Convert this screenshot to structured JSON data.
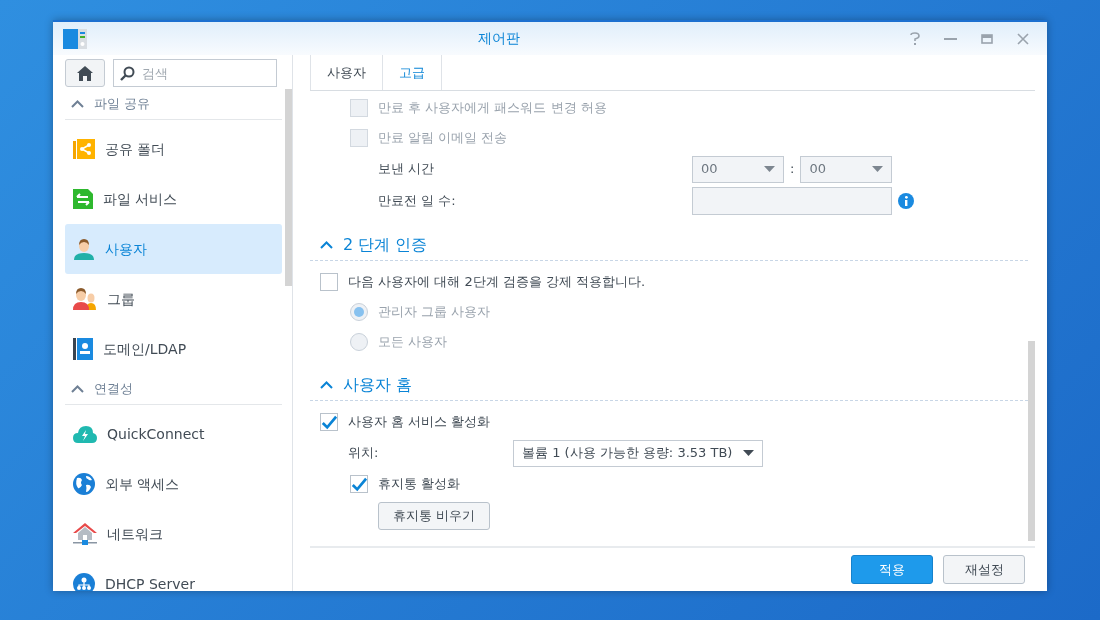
{
  "window": {
    "title": "제어판"
  },
  "sidebar": {
    "search": {
      "placeholder": "검색"
    },
    "sections": [
      {
        "title": "파일 공유",
        "expanded": true,
        "items": [
          {
            "label": "공유 폴더",
            "selected": false
          },
          {
            "label": "파일 서비스",
            "selected": false
          },
          {
            "label": "사용자",
            "selected": true
          },
          {
            "label": "그룹",
            "selected": false
          },
          {
            "label": "도메인/LDAP",
            "selected": false
          }
        ]
      },
      {
        "title": "연결성",
        "expanded": true,
        "items": [
          {
            "label": "QuickConnect",
            "selected": false
          },
          {
            "label": "외부 액세스",
            "selected": false
          },
          {
            "label": "네트워크",
            "selected": false
          },
          {
            "label": "DHCP Server",
            "selected": false
          }
        ]
      }
    ]
  },
  "tabs": [
    {
      "label": "사용자",
      "selected": false
    },
    {
      "label": "고급",
      "selected": true
    }
  ],
  "password_expiry": {
    "options": [
      {
        "label": "만료 후 사용자에게 패스워드 변경 허용",
        "checked": false,
        "disabled": true
      },
      {
        "label": "만료 알림 이메일 전송",
        "checked": false,
        "disabled": true
      }
    ],
    "send_time": {
      "label": "보낸 시간",
      "hour": "00",
      "separator": ":",
      "minute": "00"
    },
    "days_before": {
      "label": "만료전 일 수:"
    }
  },
  "two_step": {
    "title": "2 단계 인증",
    "expanded": true,
    "enforce": {
      "label": "다음 사용자에 대해 2단계 검증을 강제 적용합니다.",
      "checked": false
    },
    "options": [
      {
        "label": "관리자 그룹 사용자",
        "selected": true,
        "disabled": true
      },
      {
        "label": "모든 사용자",
        "selected": false,
        "disabled": true
      }
    ]
  },
  "user_home": {
    "title": "사용자 홈",
    "expanded": true,
    "enable": {
      "label": "사용자 홈 서비스 활성화",
      "checked": true
    },
    "location": {
      "label": "위치:",
      "value": "볼륨 1 (사용 가능한 용량: 3.53 TB)"
    },
    "recycle_bin": {
      "label": "휴지통 활성화",
      "checked": true
    },
    "empty_button": "휴지통 비우기"
  },
  "footer_buttons": [
    {
      "label": "적용",
      "kind": "primary"
    },
    {
      "label": "재설정",
      "kind": "secondary"
    }
  ]
}
